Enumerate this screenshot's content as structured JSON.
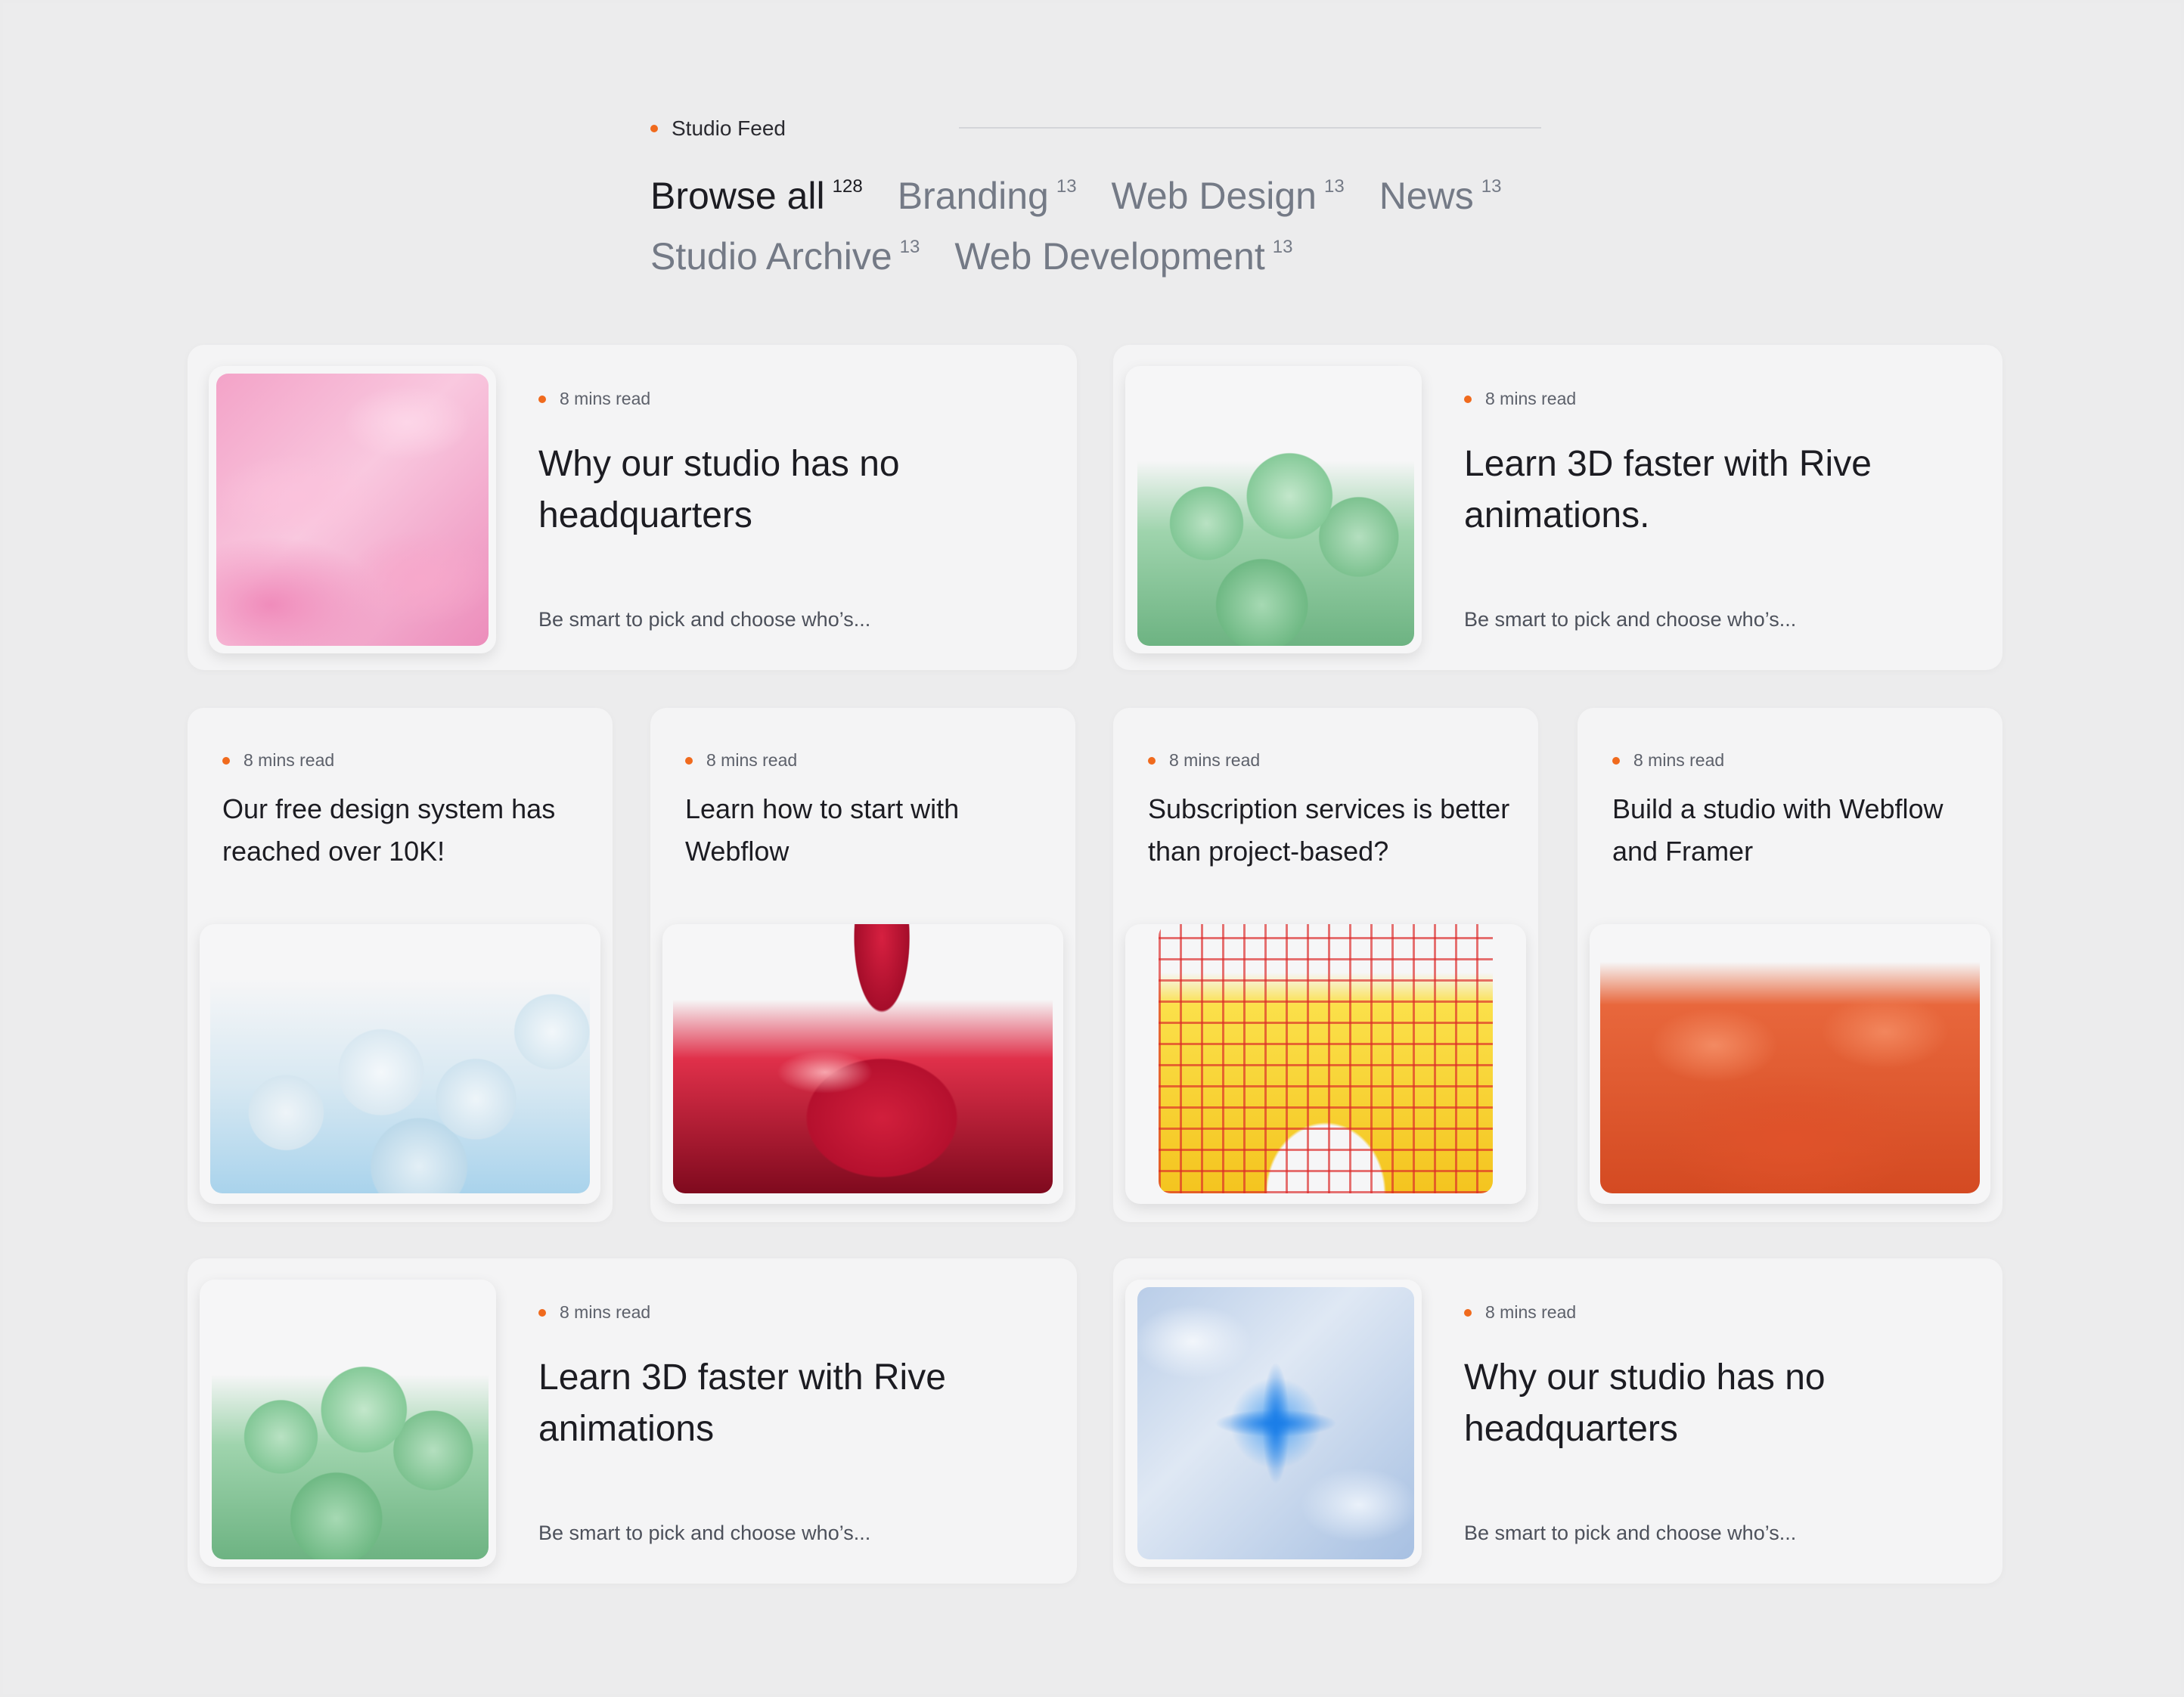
{
  "header": {
    "feed_label": "Studio Feed"
  },
  "filters": [
    {
      "label": "Browse all",
      "count": "128",
      "active": true
    },
    {
      "label": "Branding",
      "count": "13",
      "active": false
    },
    {
      "label": "Web Design",
      "count": "13",
      "active": false
    },
    {
      "label": "News",
      "count": "13",
      "active": false
    },
    {
      "label": "Studio Archive",
      "count": "13",
      "active": false
    },
    {
      "label": "Web Development",
      "count": "13",
      "active": false
    }
  ],
  "posts": [
    {
      "read_time": "8 mins read",
      "title": "Why our studio has no headquarters",
      "excerpt": "Be smart to pick and choose who’s...",
      "image": "pink-blob-art"
    },
    {
      "read_time": "8 mins read",
      "title": "Learn 3D faster with Rive animations.",
      "excerpt": "Be smart to pick and choose who’s...",
      "image": "green-scaled-blob-art"
    },
    {
      "read_time": "8 mins read",
      "title": "Our free design system has reached over 10K!",
      "image": "white-cloud-art"
    },
    {
      "read_time": "8 mins read",
      "title": "Learn how to start with Webflow",
      "image": "red-glass-heart-art"
    },
    {
      "read_time": "8 mins read",
      "title": "Subscription services is better than project-based?",
      "image": "yellow-grid-arch-art"
    },
    {
      "read_time": "8 mins read",
      "title": "Build a studio with Webflow and Framer",
      "image": "orange-puffer-art"
    },
    {
      "read_time": "8 mins read",
      "title": "Learn 3D faster with Rive animations",
      "excerpt": "Be smart to pick and choose who’s...",
      "image": "green-scaled-blob-art"
    },
    {
      "read_time": "8 mins read",
      "title": "Why our studio has no headquarters",
      "excerpt": "Be smart to pick and choose who’s...",
      "image": "blue-chrome-star-art"
    }
  ],
  "colors": {
    "accent_dot": "#f06a1d",
    "background": "#ececed",
    "card": "#f4f4f5",
    "text_primary": "#1c1c22",
    "text_muted": "#747a86"
  }
}
